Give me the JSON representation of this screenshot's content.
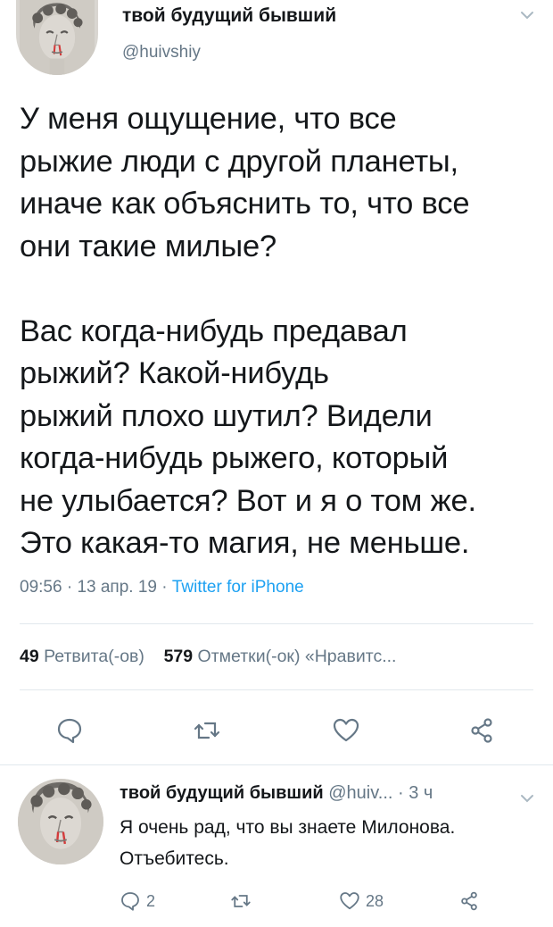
{
  "tweet": {
    "author_name": "твой будущий бывший",
    "author_handle": "@huivshiy",
    "body": "У меня ощущение, что все\nрыжие люди с другой планеты,\nиначе как объяснить то, что все\nони такие милые?\n\nВас когда-нибудь предавал\nрыжий? Какой-нибудь\nрыжий плохо шутил? Видели\nкогда-нибудь рыжего, который\nне улыбается? Вот и я о том же.\nЭто какая-то магия, не меньше.",
    "time": "09:56",
    "date": "13 апр. 19",
    "separator": "·",
    "source": "Twitter for iPhone"
  },
  "stats": {
    "retweets_count": "49",
    "retweets_label": "Ретвита(-ов)",
    "likes_count": "579",
    "likes_label": "Отметки(-ок) «Нравитс..."
  },
  "icons": {
    "reply": "reply-icon",
    "retweet": "retweet-icon",
    "like": "heart-icon",
    "share": "share-icon",
    "menu": "chevron-down-icon"
  },
  "reply": {
    "author_name": "твой будущий бывший",
    "author_handle": "@huiv...",
    "time": "· 3 ч",
    "body": "Я очень рад, что вы знаете Милонова. Отъебитесь.",
    "reply_count": "2",
    "like_count": "28"
  },
  "colors": {
    "accent": "#1da1f2",
    "muted": "#657786",
    "text": "#14171a"
  }
}
